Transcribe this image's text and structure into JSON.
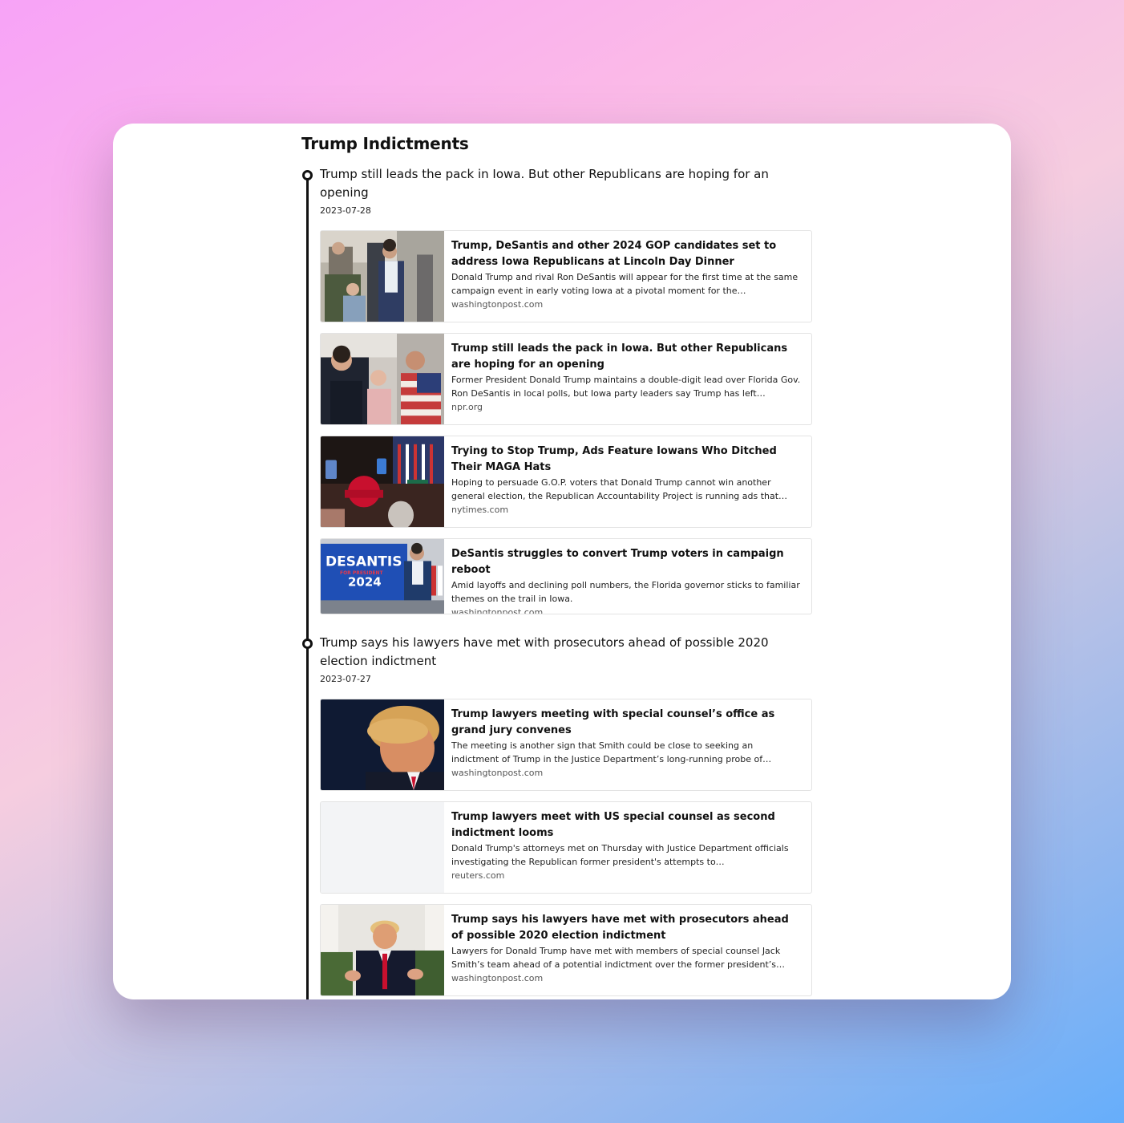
{
  "page": {
    "title": "Trump Indictments"
  },
  "events": [
    {
      "title": "Trump still leads the pack in Iowa. But other Republicans are hoping for an opening",
      "date": "2023-07-28",
      "articles": [
        {
          "title": "Trump, DeSantis and other 2024 GOP candidates set to address Iowa Republicans at Lincoln Day Dinner",
          "description": "Donald Trump and rival Ron DeSantis will appear for the first time at the same campaign event in early voting Iowa at a pivotal moment for the…",
          "source": "washingtonpost.com",
          "image": "photo-candidate-crowd"
        },
        {
          "title": "Trump still leads the pack in Iowa. But other Republicans are hoping for an opening",
          "description": "Former President Donald Trump maintains a double-digit lead over Florida Gov. Ron DeSantis in local polls, but Iowa party leaders say Trump has left…",
          "source": "npr.org",
          "image": "photo-candidates-laughing"
        },
        {
          "title": "Trying to Stop Trump, Ads Feature Iowans Who Ditched Their MAGA Hats",
          "description": "Hoping to persuade G.O.P. voters that Donald Trump cannot win another general election, the Republican Accountability Project is running ads that…",
          "source": "nytimes.com",
          "image": "photo-rally-crowd"
        },
        {
          "title": "DeSantis struggles to convert Trump voters in campaign reboot",
          "description": "Amid layoffs and declining poll numbers, the Florida governor sticks to familiar themes on the trail in Iowa.",
          "source": "washingtonpost.com",
          "image": "photo-desantis-banner",
          "banner_text": [
            "DESANTIS",
            "FOR PRESIDENT",
            "2024"
          ]
        }
      ]
    },
    {
      "title": "Trump says his lawyers have met with prosecutors ahead of possible 2020 election indictment",
      "date": "2023-07-27",
      "articles": [
        {
          "title": "Trump lawyers meeting with special counsel’s office as grand jury convenes",
          "description": "The meeting is another sign that Smith could be close to seeking an indictment of Trump in the Justice Department’s long-running probe of…",
          "source": "washingtonpost.com",
          "image": "photo-trump-portrait"
        },
        {
          "title": "Trump lawyers meet with US special counsel as second indictment looms",
          "description": "Donald Trump's attorneys met on Thursday with Justice Department officials investigating the Republican former president's attempts to…",
          "source": "reuters.com",
          "image": "image-placeholder"
        },
        {
          "title": "Trump says his lawyers have met with prosecutors ahead of possible 2020 election indictment",
          "description": "Lawyers for Donald Trump have met with members of special counsel Jack Smith’s team ahead of a potential indictment over the former president’s…",
          "source": "washingtonpost.com",
          "image": "photo-trump-speaking"
        }
      ]
    }
  ]
}
